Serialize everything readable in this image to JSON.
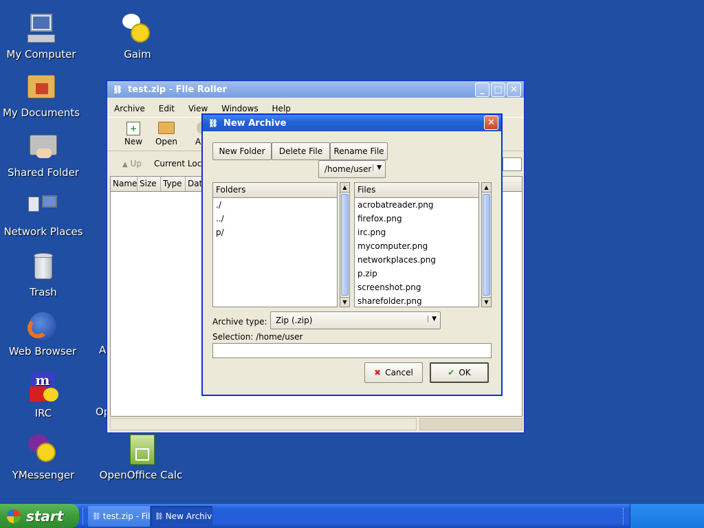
{
  "desktop": {
    "icons": [
      {
        "label": "My Computer",
        "icon": "computer-icon"
      },
      {
        "label": "Gaim",
        "icon": "gaim-icon"
      },
      {
        "label": "My Documents",
        "icon": "folder-home-icon"
      },
      {
        "label": "Shared Folder",
        "icon": "shared-folder-icon"
      },
      {
        "label": "Network Places",
        "icon": "network-icon"
      },
      {
        "label": "Trash",
        "icon": "trash-icon"
      },
      {
        "label": "Web Browser",
        "icon": "firefox-icon"
      },
      {
        "label": "IRC",
        "icon": "irc-icon"
      },
      {
        "label": "YMessenger",
        "icon": "ymessenger-icon"
      },
      {
        "label": "OpenOffice Calc",
        "icon": "calc-icon"
      }
    ],
    "hidden_labels": {
      "a": "A",
      "op": "Op"
    }
  },
  "file_roller": {
    "title": "test.zip  - File Roller",
    "menu": [
      "Archive",
      "Edit",
      "View",
      "Windows",
      "Help"
    ],
    "toolbar": {
      "new": "New",
      "open": "Open",
      "add_partial": "A"
    },
    "location": {
      "up": "Up",
      "label": "Current Loca"
    },
    "columns": [
      "Name",
      "Size",
      "Type",
      "Date"
    ]
  },
  "new_archive": {
    "title": "New Archive",
    "buttons": {
      "new_folder": "New Folder",
      "delete_file": "Delete File",
      "rename_file": "Rename File"
    },
    "path": "/home/user",
    "folders_header": "Folders",
    "folders": [
      "./",
      "../",
      "p/"
    ],
    "files_header": "Files",
    "files": [
      "acrobatreader.png",
      "firefox.png",
      "irc.png",
      "mycomputer.png",
      "networkplaces.png",
      "p.zip",
      "screenshot.png",
      "sharefolder.png"
    ],
    "archive_type_label": "Archive type:",
    "archive_type_value": "Zip (.zip)",
    "selection_label": "Selection: /home/user",
    "selection_value": "",
    "cancel": "Cancel",
    "ok": "OK"
  },
  "taskbar": {
    "start": "start",
    "tasks": [
      "test.zip  - File Roller",
      "New Archive"
    ]
  }
}
